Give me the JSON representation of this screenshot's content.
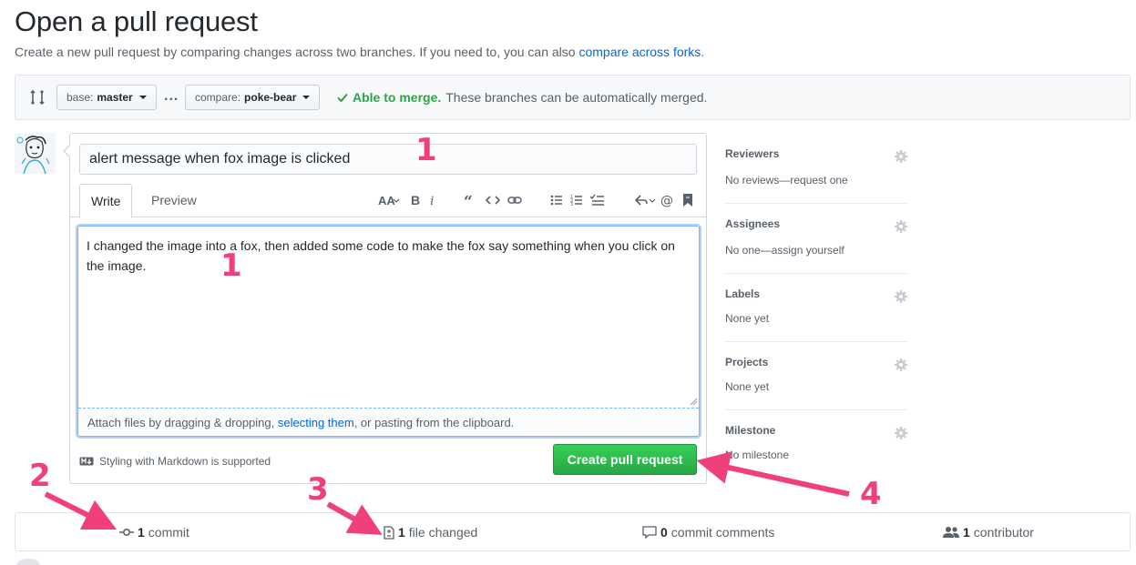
{
  "header": {
    "title": "Open a pull request",
    "subtitle": "Create a new pull request by comparing changes across two branches. If you need to, you can also",
    "subtitle_link": "compare across forks",
    "subtitle_end": "."
  },
  "range": {
    "base_prefix": "base:",
    "base_value": "master",
    "separator": "...",
    "compare_prefix": "compare:",
    "compare_value": "poke-bear",
    "merge_ok": "Able to merge.",
    "merge_text": "These branches can be automatically merged."
  },
  "form": {
    "title_value": "alert message when fox image is clicked",
    "tabs": [
      "Write",
      "Preview"
    ],
    "toolbar_icons": [
      "text-size-icon",
      "bold-icon",
      "italic-icon",
      "quote-icon",
      "code-icon",
      "link-icon",
      "bulleted-list-icon",
      "numbered-list-icon",
      "task-list-icon",
      "reply-icon",
      "mention-icon",
      "bookmark-icon"
    ],
    "body_value": "I changed the image into a fox, then added some code to make the fox say something when you click on the image.",
    "attach_pre": "Attach files by dragging & dropping,",
    "attach_link": "selecting them",
    "attach_post": ", or pasting from the clipboard.",
    "markdown_note": "Styling with Markdown is supported",
    "submit_label": "Create pull request"
  },
  "sidebar": {
    "sections": [
      {
        "heading": "Reviewers",
        "value": "No reviews—request one"
      },
      {
        "heading": "Assignees",
        "value": "No one—assign yourself"
      },
      {
        "heading": "Labels",
        "value": "None yet"
      },
      {
        "heading": "Projects",
        "value": "None yet"
      },
      {
        "heading": "Milestone",
        "value": "No milestone"
      }
    ]
  },
  "stats": {
    "commits_num": "1",
    "commits_label": "commit",
    "files_num": "1",
    "files_label": "file changed",
    "comments_num": "0",
    "comments_label": "commit comments",
    "contributors_num": "1",
    "contributors_label": "contributor"
  },
  "annotations": {
    "n1a": "1",
    "n1b": "1",
    "n2": "2",
    "n3": "3",
    "n4": "4",
    "color": "#f0407a"
  },
  "colors": {
    "link": "#0366d6",
    "success": "#28a745",
    "focus": "#79b8ff"
  }
}
